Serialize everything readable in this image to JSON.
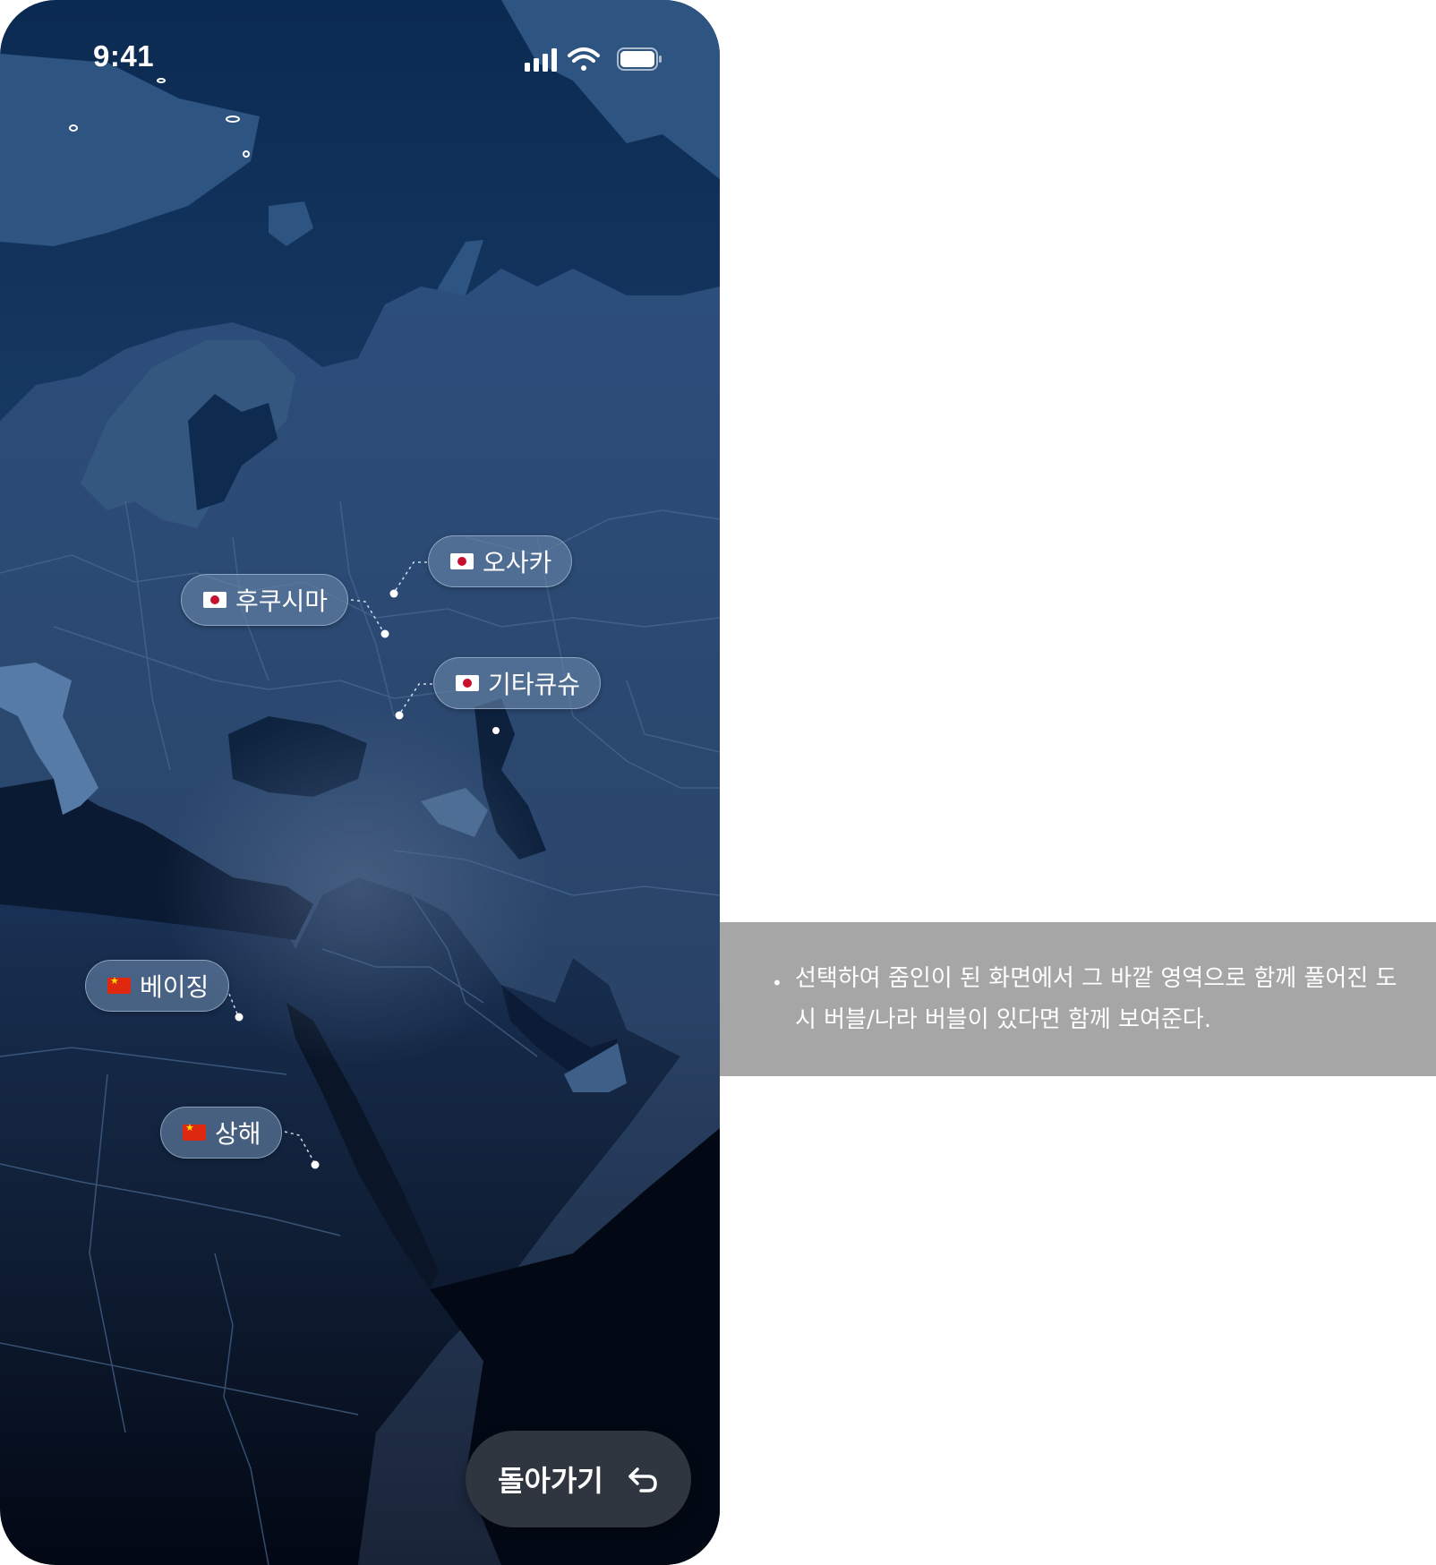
{
  "status_bar": {
    "time": "9:41"
  },
  "bubbles": [
    {
      "label": "오사카",
      "flag": "japan-flag-icon"
    },
    {
      "label": "후쿠시마",
      "flag": "japan-flag-icon"
    },
    {
      "label": "기타큐슈",
      "flag": "japan-flag-icon"
    },
    {
      "label": "베이징",
      "flag": "china-flag-icon"
    },
    {
      "label": "상해",
      "flag": "china-flag-icon"
    }
  ],
  "back_button": {
    "label": "돌아가기",
    "icon": "return-arrow-icon"
  },
  "annotation": {
    "bullet": "•",
    "text": "선택하여 줌인이 된 화면에서 그 바깥 영역으로 함께 풀어진 도시 버블/나라 버블이 있다면 함께 보여준다."
  },
  "colors": {
    "map_top": "#0b2a52",
    "map_bottom": "#020814",
    "land": "#2a4a74",
    "bubble_bg": "#6884a8",
    "button_bg": "#2f3640",
    "note_bg": "#a6a6a6"
  }
}
